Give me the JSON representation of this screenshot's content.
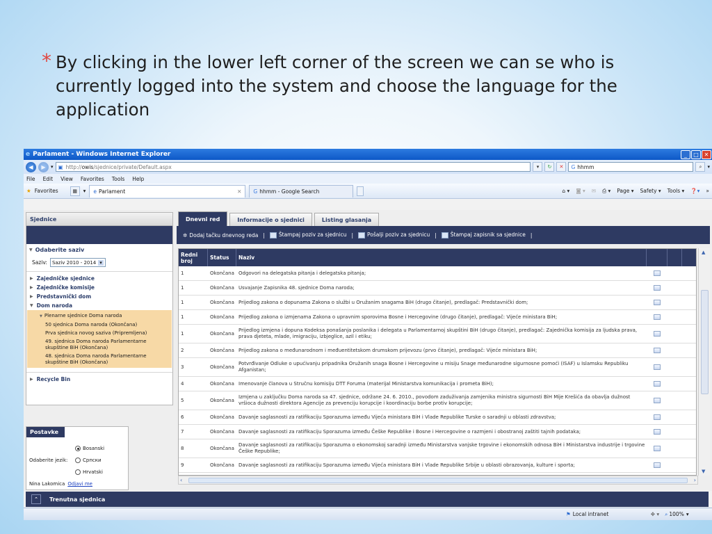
{
  "slide": {
    "bullet": "*",
    "text": "By clicking in the lower left corner of the screen we can se who is currently logged into the system and choose the language for the application"
  },
  "browser": {
    "window_title": "Parlament - Windows Internet Explorer",
    "url_prefix": "http://",
    "url_host": "owis",
    "url_path": "/sjednice/private/Default.aspx",
    "search_box": "hhmm",
    "menu": [
      "File",
      "Edit",
      "View",
      "Favorites",
      "Tools",
      "Help"
    ],
    "favorites_label": "Favorites",
    "tab_active": "Parlament",
    "tab_other": "hhmm - Google Search",
    "commands": {
      "page": "Page ▾",
      "safety": "Safety ▾",
      "tools": "Tools ▾"
    },
    "status": {
      "zone": "Local intranet",
      "zoom": "100%"
    }
  },
  "left_panel": {
    "title": "Sjednice",
    "saziv_section": "Odaberite saziv",
    "saziv_label": "Saziv:",
    "saziv_value": "Saziv 2010 - 2014",
    "items": [
      "Zajedničke sjednice",
      "Zajedničke komisije",
      "Predstavnički dom",
      "Dom naroda"
    ],
    "sub_header": "Plenarne sjednice Doma naroda",
    "sub_items": [
      "50 sjednica Doma naroda (Okončana)",
      "Prva sjednica novog saziva (Pripremljena)",
      "49. sjednica Doma naroda Parlamentarne skupštine BiH (Okončana)",
      "48. sjednica Doma naroda Parlamentarne skupštine BiH (Okončana)"
    ],
    "recycle": "Recycle Bin"
  },
  "postavke": {
    "title": "Postavke",
    "language_label": "Odaberite jezik:",
    "languages": [
      "Bosanski",
      "Српски",
      "Hrvatski"
    ],
    "selected_language": "Bosanski",
    "user": "Nina Lakomica",
    "logout": "Odjavi me"
  },
  "main": {
    "tabs": [
      "Dnevni red",
      "Informacije o sjednici",
      "Listing glasanja"
    ],
    "toolbar": [
      "Dodaj tačku dnevnog reda",
      "Štampaj poziv za sjednicu",
      "Pošalji poziv za sjednicu",
      "Štampaj zapisnik sa sjednice"
    ],
    "sep": "|",
    "columns": [
      "Redni broj",
      "Status",
      "Naziv"
    ],
    "rows": [
      {
        "n": "1",
        "s": "Okončana",
        "t": "Odgovori na delegatska pitanja i delegatska pitanja;"
      },
      {
        "n": "1",
        "s": "Okončana",
        "t": "Usvajanje Zapisnika 48. sjednice Doma naroda;"
      },
      {
        "n": "1",
        "s": "Okončana",
        "t": "Prijedlog zakona o dopunama Zakona o službi u Oružanim snagama BiH (drugo čitanje), predlagač: Predstavnički dom;"
      },
      {
        "n": "1",
        "s": "Okončana",
        "t": "Prijedlog zakona o izmjenama Zakona o upravnim sporovima Bosne i Hercegovine (drugo čitanje), predlagač: Vijeće ministara BiH;"
      },
      {
        "n": "1",
        "s": "Okončana",
        "t": "Prijedlog izmjena i dopuna Kodeksa ponašanja poslanika i delegata u Parlamentarnoj skupštini BiH (drugo čitanje), predlagač: Zajednička komisija za ljudska prava, prava djeteta, mlade, imigraciju, izbjeglice, azil i etiku;"
      },
      {
        "n": "2",
        "s": "Okončana",
        "t": "Prijedlog zakona o međunarodnom i međuentitetskom drumskom prijevozu (prvo čitanje), predlagač: Vijeće ministara BiH;"
      },
      {
        "n": "3",
        "s": "Okončana",
        "t": "Potvrđivanje Odluke o upućivanju pripadnika Oružanih snaga Bosne i Hercegovine u misiju Snage međunarodne sigurnosne pomoći (ISAF) u Islamsku Republiku Afganistan;"
      },
      {
        "n": "4",
        "s": "Okončana",
        "t": "Imenovanje članova u Stručnu komisiju DTT Foruma (materijal Ministarstva komunikacija i prometa BiH);"
      },
      {
        "n": "5",
        "s": "Okončana",
        "t": "Izmjena u zaključku Doma naroda sa 47. sjednice, održane 24. 6. 2010., povodom zaduživanja zamjenika ministra sigurnosti BiH Mije Krešića da obavlja dužnost vršioca dužnosti direktora Agencije za prevenciju korupcije i koordinaciju borbe protiv korupcije;"
      },
      {
        "n": "6",
        "s": "Okončana",
        "t": "Davanje saglasnosti za ratifikaciju Sporazuma između Vijeća ministara BiH i Vlade Republike Turske o saradnji u oblasti zdravstva;"
      },
      {
        "n": "7",
        "s": "Okončana",
        "t": "Davanje saglasnosti za ratifikaciju Sporazuma između Češke Republike i Bosne i Hercegovine o razmjeni i obostranoj zaštiti tajnih podataka;"
      },
      {
        "n": "8",
        "s": "Okončana",
        "t": "Davanje saglasnosti za ratifikaciju Sporazuma o ekonomskoj saradnji između Ministarstva vanjske trgovine i ekonomskih odnosa BiH i Ministarstva industrije i trgovine Češke Republike;"
      },
      {
        "n": "9",
        "s": "Okončana",
        "t": "Davanje saglasnosti za ratifikaciju Sporazuma između Vijeća ministara BiH i Vlade Republike Srbije u oblasti obrazovanja, kulture i sporta;"
      }
    ]
  },
  "footer": {
    "trenutna": "Trenutna sjednica"
  }
}
